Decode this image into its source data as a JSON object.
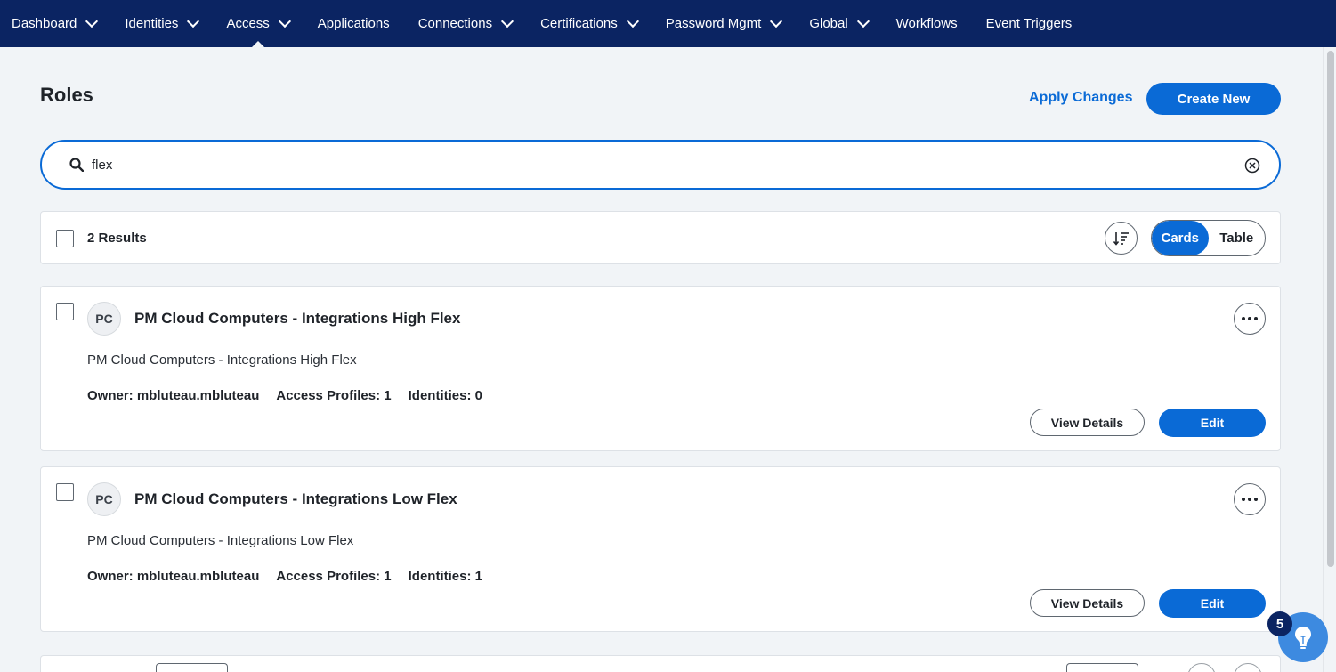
{
  "nav": {
    "items": [
      {
        "label": "Dashboard",
        "dropdown": true,
        "active": false
      },
      {
        "label": "Identities",
        "dropdown": true,
        "active": false
      },
      {
        "label": "Access",
        "dropdown": true,
        "active": true
      },
      {
        "label": "Applications",
        "dropdown": false,
        "active": false
      },
      {
        "label": "Connections",
        "dropdown": true,
        "active": false
      },
      {
        "label": "Certifications",
        "dropdown": true,
        "active": false
      },
      {
        "label": "Password Mgmt",
        "dropdown": true,
        "active": false
      },
      {
        "label": "Global",
        "dropdown": true,
        "active": false
      },
      {
        "label": "Workflows",
        "dropdown": false,
        "active": false
      },
      {
        "label": "Event Triggers",
        "dropdown": false,
        "active": false
      }
    ]
  },
  "page": {
    "title": "Roles",
    "apply_changes": "Apply Changes",
    "create_new": "Create New"
  },
  "search": {
    "value": "flex",
    "placeholder": ""
  },
  "results": {
    "count_label": "2 Results",
    "view_options": [
      "Cards",
      "Table"
    ],
    "selected_view": "Cards"
  },
  "cards": [
    {
      "initials": "PC",
      "title": "PM Cloud Computers - Integrations High Flex",
      "description": "PM Cloud Computers - Integrations High Flex",
      "owner": "Owner: mbluteau.mbluteau",
      "access_profiles": "Access Profiles: 1",
      "identities": "Identities: 0",
      "view_label": "View Details",
      "edit_label": "Edit"
    },
    {
      "initials": "PC",
      "title": "PM Cloud Computers - Integrations Low Flex",
      "description": "PM Cloud Computers - Integrations Low Flex",
      "owner": "Owner: mbluteau.mbluteau",
      "access_profiles": "Access Profiles: 1",
      "identities": "Identities: 1",
      "view_label": "View Details",
      "edit_label": "Edit"
    }
  ],
  "help": {
    "badge_count": "5"
  },
  "colors": {
    "nav_bg": "#0b2462",
    "accent": "#0a6ad6",
    "page_bg": "#f1f4f7"
  },
  "icons": {
    "search": "search-icon",
    "clear": "clear-circle-icon",
    "sort": "sort-icon",
    "more": "ellipsis-icon",
    "help": "lightbulb-icon"
  }
}
